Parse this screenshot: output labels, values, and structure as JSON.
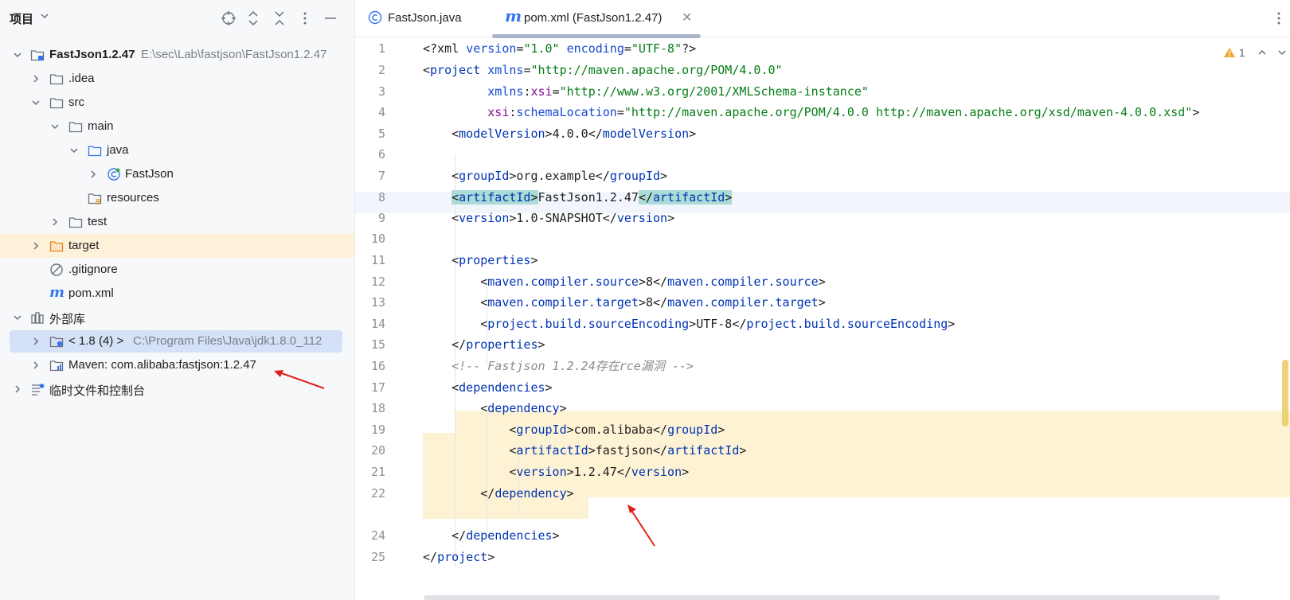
{
  "sidebar": {
    "title": "项目",
    "tree": [
      {
        "label": "FastJson1.2.47",
        "path": "E:\\sec\\Lab\\fastjson\\FastJson1.2.47",
        "icon": "module-folder-icon"
      },
      {
        "label": ".idea",
        "icon": "folder-icon"
      },
      {
        "label": "src",
        "icon": "folder-icon"
      },
      {
        "label": "main",
        "icon": "folder-icon"
      },
      {
        "label": "java",
        "icon": "source-folder-icon"
      },
      {
        "label": "FastJson",
        "icon": "package-class-icon"
      },
      {
        "label": "resources",
        "icon": "resources-folder-icon"
      },
      {
        "label": "test",
        "icon": "folder-icon"
      },
      {
        "label": "target",
        "icon": "excluded-folder-icon"
      },
      {
        "label": ".gitignore",
        "icon": "ignore-file-icon"
      },
      {
        "label": "pom.xml",
        "icon": "maven-icon"
      },
      {
        "label": "外部库",
        "icon": "library-icon"
      },
      {
        "label": "< 1.8 (4) >",
        "path": "C:\\Program Files\\Java\\jdk1.8.0_112",
        "icon": "jdk-icon"
      },
      {
        "label": "Maven: com.alibaba:fastjson:1.2.47",
        "icon": "jar-library-icon"
      },
      {
        "label": "临时文件和控制台",
        "icon": "scratches-icon"
      }
    ]
  },
  "tabs": [
    {
      "label": "FastJson.java",
      "icon": "class-icon"
    },
    {
      "label": "pom.xml (FastJson1.2.47)",
      "icon": "maven-icon",
      "active": true
    }
  ],
  "editor": {
    "warning_count": "1",
    "line_numbers": [
      "1",
      "2",
      "3",
      "4",
      "5",
      "6",
      "7",
      "8",
      "9",
      "10",
      "11",
      "12",
      "13",
      "14",
      "15",
      "16",
      "17",
      "18",
      "19",
      "20",
      "21",
      "22",
      "",
      "24",
      "25"
    ],
    "code": {
      "l1_pi_open": "<?xml ",
      "l1_a1": "version",
      "l1_v1": "\"1.0\"",
      "l1_a2": " encoding",
      "l1_v2": "\"UTF-8\"",
      "l1_pi_close": "?>",
      "project": "project",
      "xmlns": "xmlns",
      "xmlns_val": "\"http://maven.apache.org/POM/4.0.0\"",
      "xsi": "xsi",
      "xmlns_xsi_val": "\"http://www.w3.org/2001/XMLSchema-instance\"",
      "schemaLocation": "schemaLocation",
      "schema_val": "\"http://maven.apache.org/POM/4.0.0 http://maven.apache.org/xsd/maven-4.0.0.xsd\"",
      "modelVersion": "modelVersion",
      "modelVersion_val": "4.0.0",
      "groupId": "groupId",
      "groupId_val": "org.example",
      "artifactId": "artifactId",
      "artifactId_val": "FastJson1.2.47",
      "version": "version",
      "version_val": "1.0-SNAPSHOT",
      "properties": "properties",
      "mcs": "maven.compiler.source",
      "mcs_val": "8",
      "mct": "maven.compiler.target",
      "mct_val": "8",
      "pbse": "project.build.sourceEncoding",
      "pbse_val": "UTF-8",
      "comment": "<!-- Fastjson 1.2.24存在rce漏洞 -->",
      "dependencies": "dependencies",
      "dependency": "dependency",
      "dep_groupId_val": "com.alibaba",
      "dep_artifactId_val": "fastjson",
      "dep_version_val": "1.2.47"
    }
  },
  "colors": {
    "accent_blue": "#3574f0",
    "highlight_orange": "#fdf1da",
    "selection_blue": "#d5e1f7",
    "annotation_red": "#e0201b",
    "dependency_band": "#fdf3d4"
  }
}
